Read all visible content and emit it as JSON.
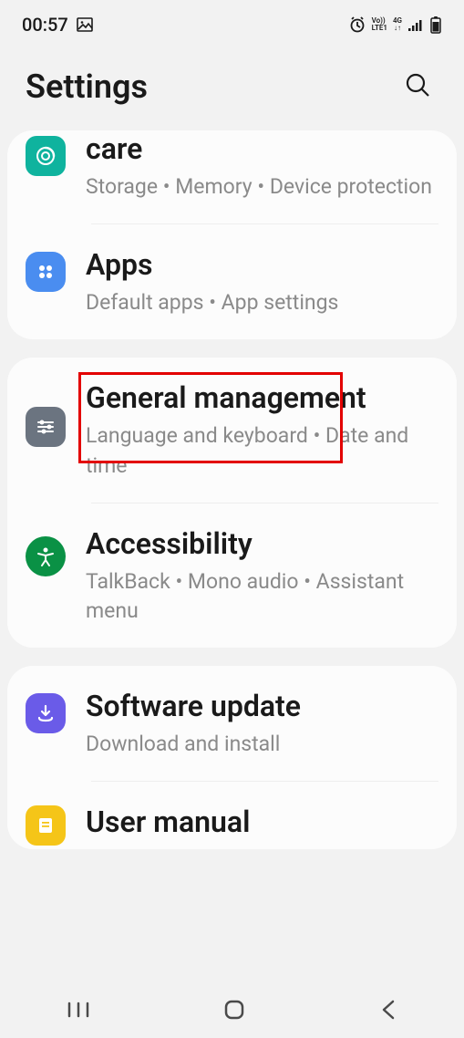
{
  "status": {
    "time": "00:57",
    "network_label_top": "Vo))",
    "network_label_bottom": "LTE1",
    "network_speed": "4G"
  },
  "header": {
    "title": "Settings"
  },
  "groups": [
    {
      "items": [
        {
          "title": "care",
          "sub": "Storage  •  Memory  •  Device protection"
        },
        {
          "title": "Apps",
          "sub": "Default apps  •  App settings"
        }
      ]
    },
    {
      "items": [
        {
          "title": "General management",
          "sub": "Language and keyboard  •  Date and time"
        },
        {
          "title": "Accessibility",
          "sub": "TalkBack  •  Mono audio  •  Assistant menu"
        }
      ]
    },
    {
      "items": [
        {
          "title": "Software update",
          "sub": "Download and install"
        },
        {
          "title": "User manual",
          "sub": ""
        }
      ]
    }
  ],
  "highlight": {
    "target": "General management"
  }
}
